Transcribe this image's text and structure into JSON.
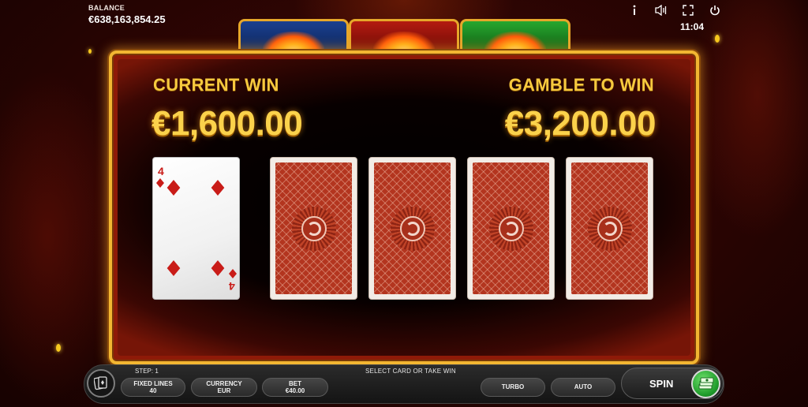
{
  "header": {
    "balance_label": "BALANCE",
    "balance_value": "€638,163,854.25",
    "clock": "11:04",
    "icons": [
      "info-icon",
      "sound-icon",
      "fullscreen-icon",
      "power-icon"
    ]
  },
  "suit_tabs": [
    {
      "name": "blue",
      "color": "#1a3f8f"
    },
    {
      "name": "red",
      "color": "#b41b10"
    },
    {
      "name": "green",
      "color": "#27a72e"
    }
  ],
  "gamble": {
    "current_win_label": "CURRENT WIN",
    "current_win_value": "€1,600.00",
    "gamble_to_win_label": "GAMBLE TO WIN",
    "gamble_to_win_value": "€3,200.00",
    "dealer_card": {
      "rank": "4",
      "suit": "diamonds",
      "color": "#c91c18"
    },
    "face_down_cards": 4
  },
  "bottom_bar": {
    "step_text": "STEP: 1",
    "hint_text": "SELECT CARD OR TAKE WIN",
    "fixed_lines_label": "FIXED LINES",
    "fixed_lines_value": "40",
    "currency_label": "CURRENCY",
    "currency_value": "EUR",
    "bet_label": "BET",
    "bet_value": "€40.00",
    "turbo_label": "TURBO",
    "auto_label": "AUTO",
    "spin_label": "SPIN"
  },
  "colors": {
    "gold": "#f6c93e",
    "frame": "#f2b632",
    "card_back": "#b3351f",
    "collect_green": "#1f9c2b"
  }
}
